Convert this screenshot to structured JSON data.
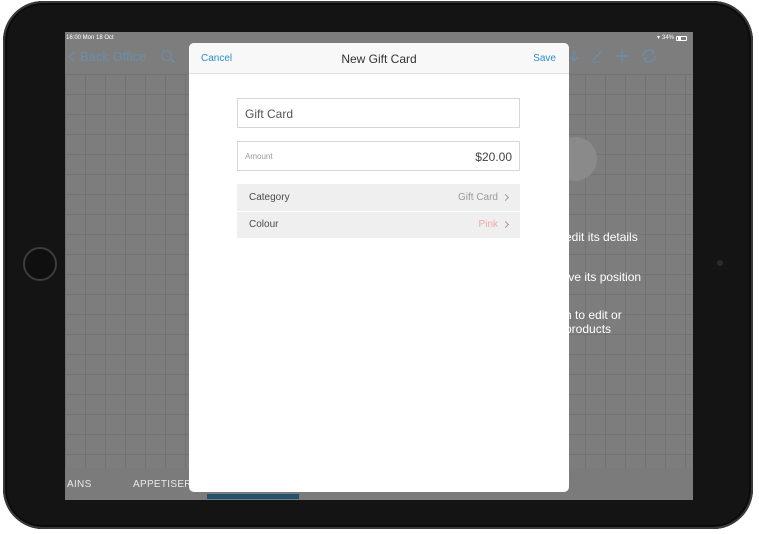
{
  "status_bar": {
    "time_date": "16:00  Mon 18 Oct",
    "battery": "34%"
  },
  "nav": {
    "back_label": "Back Office"
  },
  "hints": {
    "line1": "o edit its details",
    "line2": "nove its position",
    "line3a": "om to edit or",
    "line3b": "e products"
  },
  "bottom_tabs": [
    "AINS",
    "APPETISER"
  ],
  "modal": {
    "cancel_label": "Cancel",
    "title": "New Gift Card",
    "save_label": "Save",
    "name_value": "Gift Card",
    "amount_label": "Amount",
    "amount_value": "$20.00",
    "category_label": "Category",
    "category_value": "Gift Card",
    "colour_label": "Colour",
    "colour_value": "Pink"
  },
  "colors": {
    "accent": "#2f8ed0",
    "nav_tint": "#6b8fa9",
    "colour_pink": "#f1a8a3",
    "selected_tab": "#22546d"
  },
  "icons": {
    "nav": [
      "search-icon",
      "download-icon",
      "pencil-icon",
      "plus-icon",
      "sync-icon"
    ],
    "status": [
      "wifi-icon",
      "battery-icon"
    ]
  }
}
